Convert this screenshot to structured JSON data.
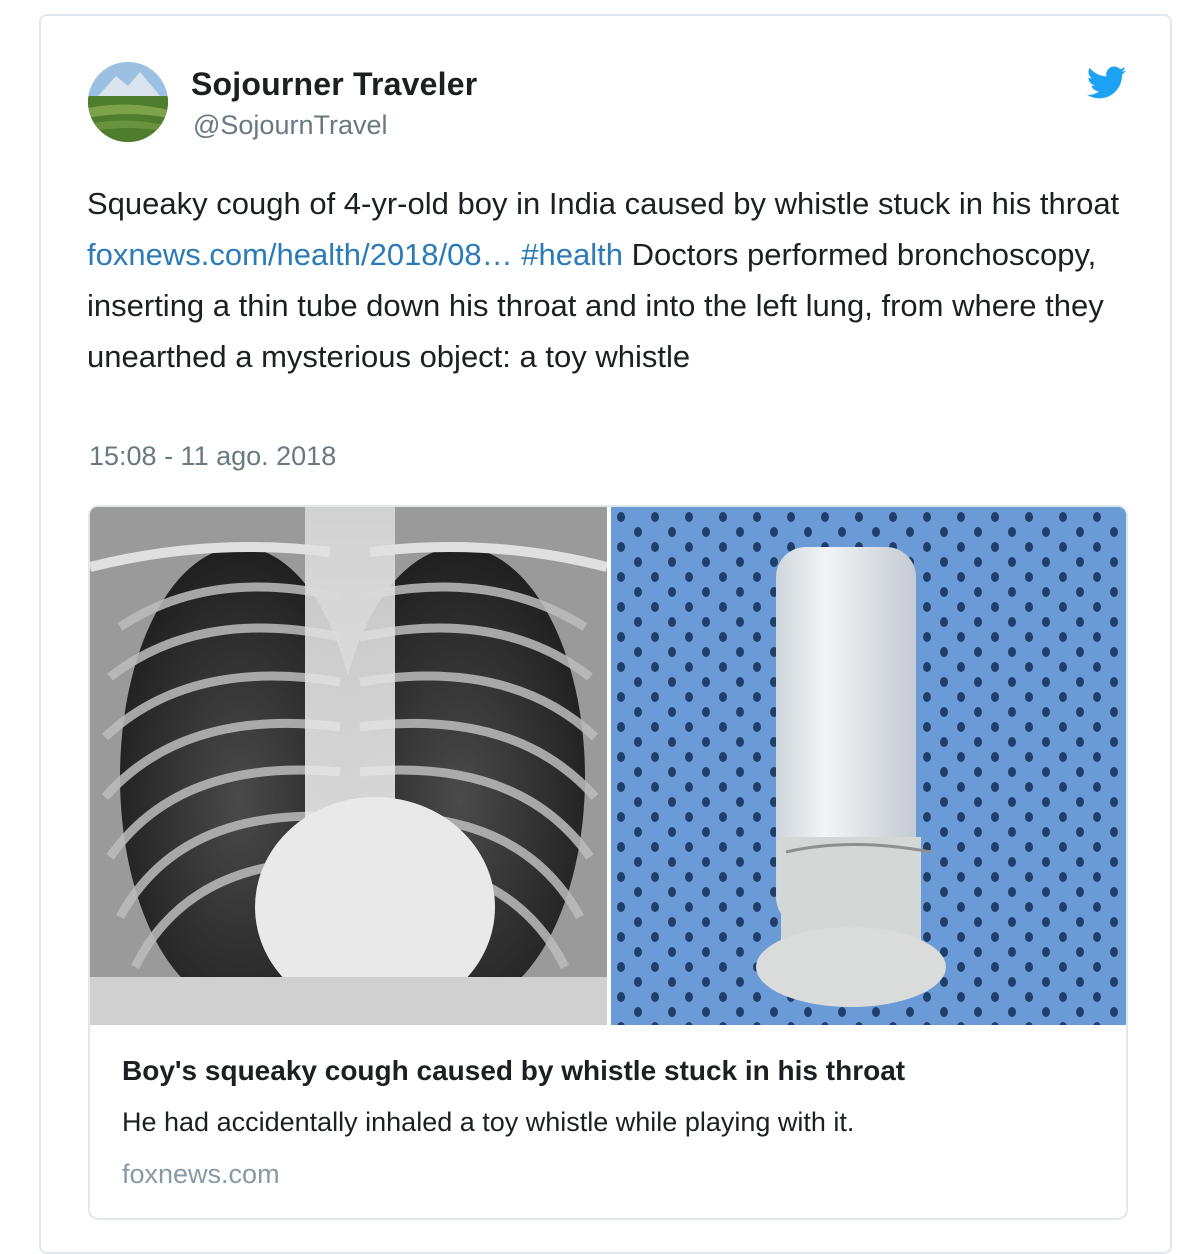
{
  "tweet": {
    "author_name": "Sojourner Traveler",
    "author_handle": "@SojournTravel",
    "text_part1": "Squeaky cough of 4-yr-old boy in India caused by whistle stuck in his throat ",
    "link": "foxnews.com/health/2018/08…",
    "hashtag": "#health",
    "text_part2": " Doctors performed bronchoscopy, inserting a thin tube down his throat and into the left lung, from where they unearthed a mysterious object: a toy whistle",
    "timestamp": "15:08 - 11 ago. 2018"
  },
  "card": {
    "title": "Boy's squeaky cough caused by whistle stuck in his throat",
    "description": "He had accidentally inhaled a toy whistle while playing with it.",
    "domain": "foxnews.com"
  },
  "icons": {
    "brand": "twitter-bird-icon"
  },
  "colors": {
    "link": "#2b7bb9",
    "twitter_blue": "#1da1f2",
    "secondary_text": "#697882",
    "border": "#e1e8ed"
  }
}
